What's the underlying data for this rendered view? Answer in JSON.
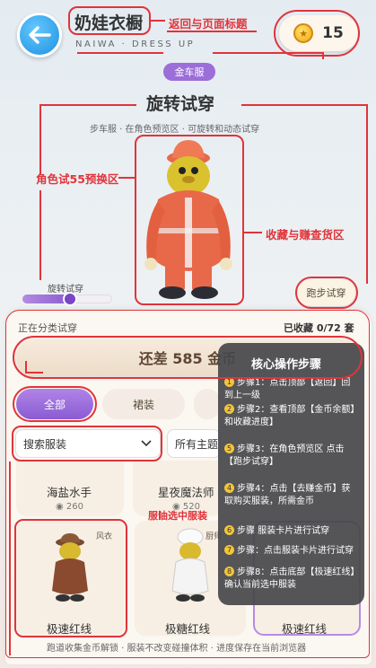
{
  "header": {
    "title": "奶娃衣橱",
    "subtitle": "NAIWA · DRESS UP",
    "coins": "15",
    "tag": "金车服"
  },
  "section": {
    "title": "旋转试穿",
    "desc": "步车服 · 在角色预览区 · 可旋转和动态试穿"
  },
  "annotations": {
    "back_title": "返回与页面标题",
    "preview": "角色试55预换区",
    "collect": "收藏与赚查货区",
    "selected": "服油选中服装"
  },
  "controls": {
    "rotate_label": "旋转试穿",
    "rotate_value": 0.5,
    "run_label": "跑步试穿"
  },
  "panel": {
    "category_text": "正在分类试穿",
    "collected_text": "已收藏 0/72 套",
    "cta_label": "还差 585 金币",
    "tabs": [
      "全部",
      "裙装"
    ],
    "search_label": "搜索服装",
    "filter_label": "所有主题",
    "top_cards": [
      {
        "name": "海盐水手",
        "price": "260"
      },
      {
        "name": "星夜魔法师",
        "price": "520"
      }
    ],
    "cards": [
      {
        "name": "极速红线",
        "tag": "风衣"
      },
      {
        "name": "极糖红线",
        "tag": "厨师"
      },
      {
        "name": "极速红线",
        "tag": ""
      }
    ],
    "footer": "跑道收集金币解锁 · 服装不改变碰撞体积 · 进度保存在当前浏览器"
  },
  "overlay": {
    "title": "核心操作步骤",
    "steps": [
      "步骤1：点击顶部【返回】回到上一级",
      "步骤2：查看顶部【金币余额】和收藏进度】",
      "步骤3：在角色预览区  点击【跑步试穿】",
      "步骤4：点击【去赚金币】获取购买服装，所需金币",
      "步骤 服装卡片进行试穿",
      "步骤：点击服装卡片进行试穿",
      "步骤8：点击底部【极速红线】确认当前选中服装"
    ],
    "step_numbers": [
      "1",
      "2",
      "5",
      "4",
      "6",
      "7",
      "8"
    ]
  },
  "colors": {
    "accent_red": "#e0343a",
    "purple": "#8a5bd3",
    "coin": "#f0a818",
    "suit": "#e8684a"
  }
}
